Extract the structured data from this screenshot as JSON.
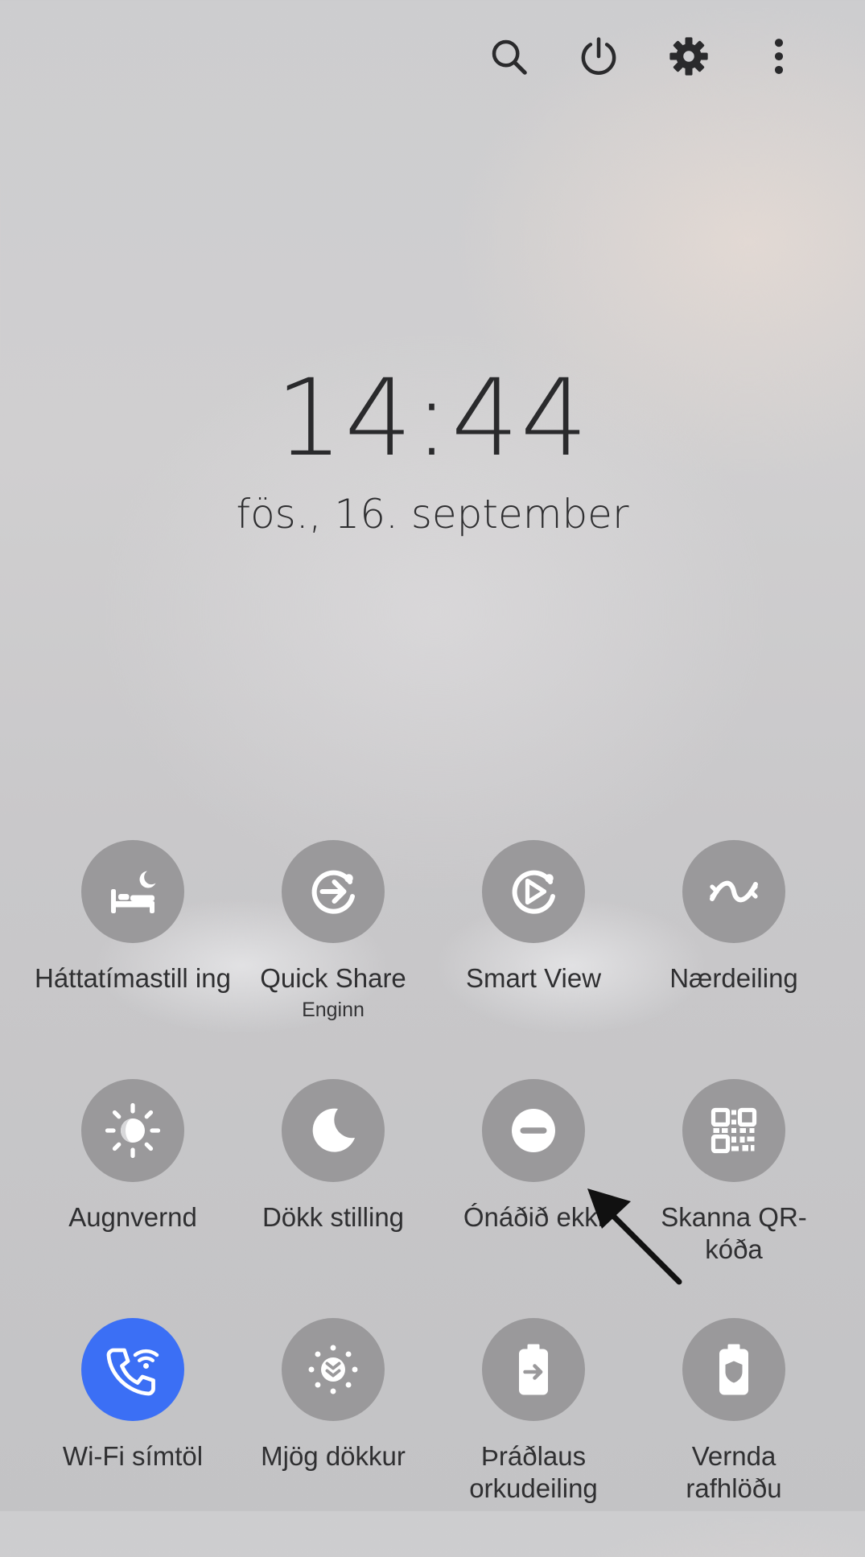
{
  "toolbar": {
    "icons": [
      "search-icon",
      "power-icon",
      "gear-icon",
      "more-vertical-icon"
    ]
  },
  "clock": {
    "time": "14:44",
    "date": "fös., 16. september"
  },
  "tiles": [
    {
      "id": "bedtime",
      "label": "Háttatímastill ing",
      "sub": "",
      "icon": "bed-moon-icon",
      "active": false
    },
    {
      "id": "quick-share",
      "label": "Quick Share",
      "sub": "Enginn",
      "icon": "quick-share-icon",
      "active": false
    },
    {
      "id": "smart-view",
      "label": "Smart View",
      "sub": "",
      "icon": "smart-view-icon",
      "active": false
    },
    {
      "id": "nearby-share",
      "label": "Nærdeiling",
      "sub": "",
      "icon": "nearby-share-icon",
      "active": false
    },
    {
      "id": "eye-comfort",
      "label": "Augnvernd",
      "sub": "",
      "icon": "eye-comfort-icon",
      "active": false
    },
    {
      "id": "dark-mode",
      "label": "Dökk stilling",
      "sub": "",
      "icon": "moon-icon",
      "active": false
    },
    {
      "id": "do-not-disturb",
      "label": "Ónáðið ekki",
      "sub": "",
      "icon": "do-not-disturb-icon",
      "active": false
    },
    {
      "id": "qr-scan",
      "label": "Skanna QR-kóða",
      "sub": "",
      "icon": "qr-code-icon",
      "active": false
    },
    {
      "id": "wifi-calling",
      "label": "Wi-Fi símtöl",
      "sub": "",
      "icon": "wifi-call-icon",
      "active": true
    },
    {
      "id": "extra-dim",
      "label": "Mjög dökkur",
      "sub": "",
      "icon": "extra-dim-icon",
      "active": false
    },
    {
      "id": "wireless-powershare",
      "label": "Þráðlaus orkudeiling",
      "sub": "",
      "icon": "battery-share-icon",
      "active": false
    },
    {
      "id": "protect-battery",
      "label": "Vernda rafhlöðu",
      "sub": "",
      "icon": "battery-shield-icon",
      "active": false
    }
  ],
  "colors": {
    "tile_inactive": "#9a999b",
    "tile_active": "#3b6ff5",
    "icon": "#ffffff"
  }
}
